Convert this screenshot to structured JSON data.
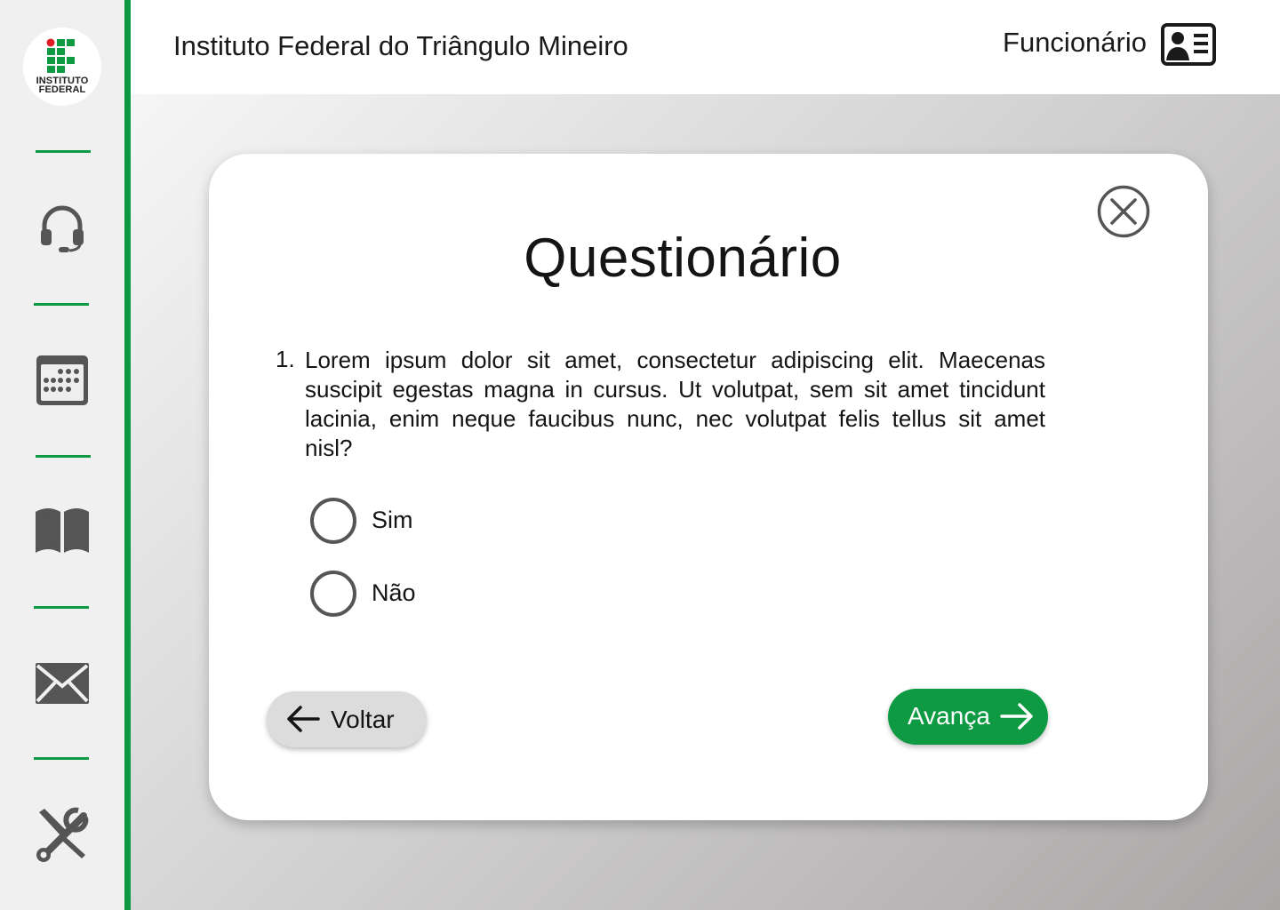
{
  "header": {
    "title": "Instituto Federal do Triângulo Mineiro",
    "user_label": "Funcionário",
    "user_icon": "id-card-icon"
  },
  "logo": {
    "line1": "INSTITUTO",
    "line2": "FEDERAL",
    "colors": {
      "green": "#0e9a43",
      "red": "#e01b24"
    }
  },
  "sidebar": {
    "items": [
      {
        "icon": "headset-icon"
      },
      {
        "icon": "calendar-icon"
      },
      {
        "icon": "book-icon"
      },
      {
        "icon": "mail-icon"
      },
      {
        "icon": "tools-icon"
      }
    ]
  },
  "modal": {
    "title": "Questionário",
    "close_icon": "close-icon",
    "question": {
      "number": "1.",
      "text": "Lorem ipsum dolor sit amet, consectetur adipiscing elit. Maecenas suscipit egestas magna in cursus. Ut volutpat, sem sit amet tincidunt  lacinia, enim neque faucibus nunc, nec volutpat felis tellus sit amet  nisl?"
    },
    "options": [
      {
        "label": "Sim",
        "selected": false
      },
      {
        "label": "Não",
        "selected": false
      }
    ],
    "back_label": "Voltar",
    "next_label": "Avança"
  },
  "colors": {
    "accent": "#0e9a43",
    "icon_gray": "#555555",
    "text": "#141414"
  }
}
